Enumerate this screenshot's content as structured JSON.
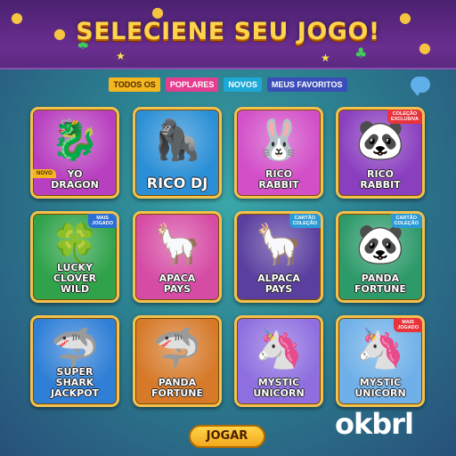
{
  "header": {
    "title": "SELECIENE SEU JOGO!"
  },
  "tabs": [
    {
      "label": "TODOS OS",
      "color": "#f3b61f"
    },
    {
      "label": "POPLARES",
      "color": "#e53d8f"
    },
    {
      "label": "NOVOS",
      "color": "#1ea8d6"
    },
    {
      "label": "MEUS FAVORITOS",
      "color": "#3b4db8"
    }
  ],
  "chat_icon": "chat-bubble-icon",
  "games": [
    {
      "name": "YO\nDRAGON",
      "icon": "🐉",
      "bg": "#b83fbf",
      "left_badge": "NOVO"
    },
    {
      "name": "RICO DJ",
      "icon": "🦍",
      "bg": "#2a8fd6",
      "big": true
    },
    {
      "name": "RICO\nRABBIT",
      "icon": "🐰",
      "bg": "#d24fc8"
    },
    {
      "name": "RICO\nRABBIT",
      "icon": "🐼",
      "bg": "#8a3fbf",
      "badge": "COLEÇÃO\nEXCLUSIVA",
      "badge_color": "#e8333a"
    },
    {
      "name": "LUCKY CLOVER\nWILD",
      "icon": "🍀",
      "bg": "#2fa24a",
      "badge": "MAIS\nJOGADO",
      "badge_color": "#2b6fd6"
    },
    {
      "name": "APACA\nPAYS",
      "icon": "🦙",
      "bg": "#d64ca5"
    },
    {
      "name": "ALPACA\nPAYS",
      "icon": "🦙",
      "bg": "#5a3f9f",
      "badge": "CARTÃO\nCOLEÇÃO",
      "badge_color": "#2b9ad6"
    },
    {
      "name": "PANDA\nFORTUNE",
      "icon": "🐼",
      "bg": "#2e9a6a",
      "badge": "CARTÃO\nCOLEÇÃO",
      "badge_color": "#2b9ad6"
    },
    {
      "name": "SUPER\nSHARK\nJACKPOT",
      "icon": "🦈",
      "bg": "#2f7fd6"
    },
    {
      "name": "PANDA\nFORTUNE",
      "icon": "🦈",
      "bg": "#d67a2a"
    },
    {
      "name": "MYSTIC\nUNICORN",
      "icon": "🦄",
      "bg": "#8f6fe0"
    },
    {
      "name": "MYSTIC\nUNICORN",
      "icon": "🦄",
      "bg": "#6fb0e8",
      "badge": "MAIS\nJOGADO",
      "badge_color": "#e8333a"
    }
  ],
  "play_button": {
    "label": "JOGAR"
  },
  "watermark": "okbrl"
}
